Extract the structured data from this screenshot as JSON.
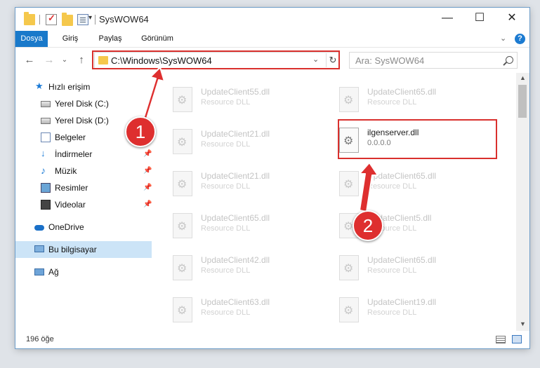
{
  "window": {
    "title": "SysWOW64",
    "minimize": "—",
    "maximize": "☐",
    "close": "✕"
  },
  "ribbon": {
    "tabs": [
      "Dosya",
      "Giriş",
      "Paylaş",
      "Görünüm"
    ],
    "help": "?",
    "expand": "⌄"
  },
  "nav": {
    "back": "←",
    "forward": "→",
    "recent": "⌄",
    "up": "↑",
    "address": "C:\\Windows\\SysWOW64",
    "address_dropdown": "⌄",
    "refresh": "↻",
    "search_placeholder": "Ara: SysWOW64"
  },
  "sidebar": {
    "items": [
      {
        "label": "Hızlı erişim",
        "icon": "star-icon"
      },
      {
        "label": "Yerel Disk (C:)",
        "icon": "drive-icon",
        "pinned": true
      },
      {
        "label": "Yerel Disk (D:)",
        "icon": "drive-icon",
        "pinned": true
      },
      {
        "label": "Belgeler",
        "icon": "documents-icon",
        "pinned": true
      },
      {
        "label": "İndirmeler",
        "icon": "download-icon",
        "pinned": true
      },
      {
        "label": "Müzik",
        "icon": "music-icon",
        "pinned": true
      },
      {
        "label": "Resimler",
        "icon": "pictures-icon",
        "pinned": true
      },
      {
        "label": "Videolar",
        "icon": "videos-icon",
        "pinned": true
      },
      {
        "label": "OneDrive",
        "icon": "cloud-icon"
      },
      {
        "label": "Bu bilgisayar",
        "icon": "computer-icon",
        "selected": true
      },
      {
        "label": "Ağ",
        "icon": "network-icon"
      }
    ],
    "pin": "📌"
  },
  "files": {
    "left": [
      {
        "name": "UpdateClient55.dll",
        "type": "Resource DLL"
      },
      {
        "name": "UpdateClient21.dll",
        "type": "Resource DLL"
      },
      {
        "name": "UpdateClient21.dll",
        "type": "Resource DLL"
      },
      {
        "name": "UpdateClient65.dll",
        "type": "Resource DLL"
      },
      {
        "name": "UpdateClient42.dll",
        "type": "Resource DLL"
      },
      {
        "name": "UpdateClient63.dll",
        "type": "Resource DLL"
      }
    ],
    "right": [
      {
        "name": "UpdateClient65.dll",
        "type": "Resource DLL"
      },
      {
        "name": "ilgenserver.dll",
        "type": "0.0.0.0",
        "highlighted": true
      },
      {
        "name": "UpdateClient65.dll",
        "type": "Resource DLL"
      },
      {
        "name": "UpdateClient5.dll",
        "type": "Resource DLL"
      },
      {
        "name": "UpdateClient65.dll",
        "type": "Resource DLL"
      },
      {
        "name": "UpdateClient19.dll",
        "type": "Resource DLL"
      }
    ]
  },
  "status": {
    "count": "196 öğe"
  },
  "annotations": {
    "badge1": "1",
    "badge2": "2",
    "color": "#de2f2f"
  },
  "colors": {
    "accent": "#1979ca",
    "selection": "#cce4f7"
  }
}
